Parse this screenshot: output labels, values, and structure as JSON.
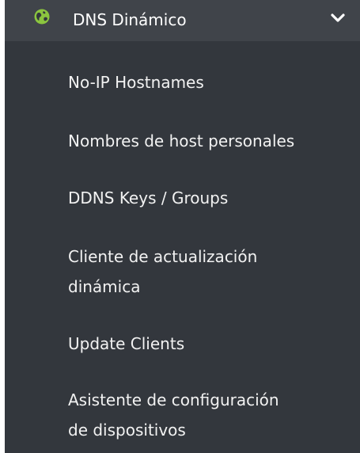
{
  "section": {
    "title": "DNS Dinámico",
    "icon": "globe-icon",
    "toggle_icon": "chevron-down-icon",
    "accent": "#8bc53f"
  },
  "items": [
    {
      "label": "No-IP Hostnames"
    },
    {
      "label": "Nombres de host personales"
    },
    {
      "label": "DDNS Keys / Groups"
    },
    {
      "label_lines": [
        "Cliente de actualización",
        "dinámica"
      ]
    },
    {
      "label": "Update Clients"
    },
    {
      "label_lines": [
        "Asistente de configuración",
        "de dispositivos"
      ]
    }
  ]
}
